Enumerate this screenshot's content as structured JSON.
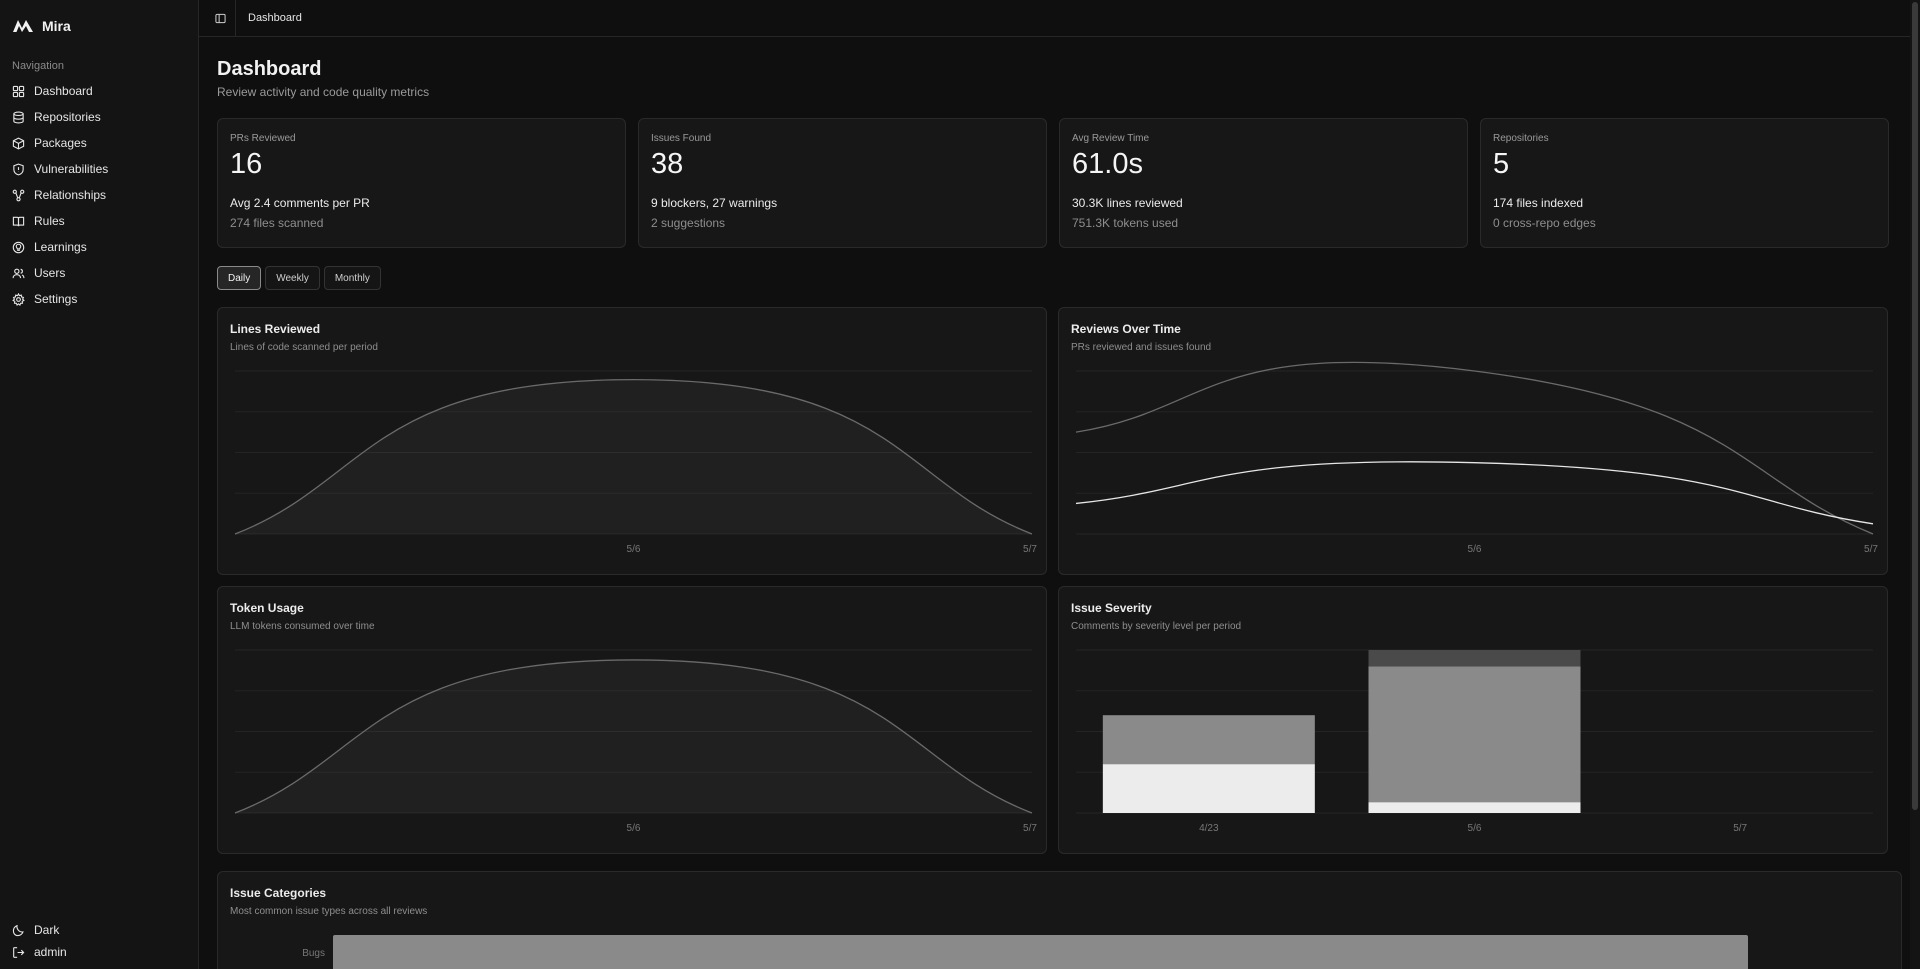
{
  "app": {
    "name": "Mira"
  },
  "sidebar": {
    "heading": "Navigation",
    "items": [
      {
        "label": "Dashboard",
        "icon": "dashboard-icon"
      },
      {
        "label": "Repositories",
        "icon": "database-icon"
      },
      {
        "label": "Packages",
        "icon": "package-icon"
      },
      {
        "label": "Vulnerabilities",
        "icon": "shield-icon"
      },
      {
        "label": "Relationships",
        "icon": "graph-icon"
      },
      {
        "label": "Rules",
        "icon": "book-icon"
      },
      {
        "label": "Learnings",
        "icon": "lightbulb-icon"
      },
      {
        "label": "Users",
        "icon": "users-icon"
      },
      {
        "label": "Settings",
        "icon": "gear-icon"
      }
    ],
    "footer": {
      "theme_label": "Dark",
      "user_label": "admin"
    }
  },
  "topbar": {
    "breadcrumb": "Dashboard"
  },
  "page": {
    "title": "Dashboard",
    "subtitle": "Review activity and code quality metrics"
  },
  "stats": [
    {
      "label": "PRs Reviewed",
      "value": "16",
      "line1": "Avg 2.4 comments per PR",
      "line2": "274 files scanned"
    },
    {
      "label": "Issues Found",
      "value": "38",
      "line1": "9 blockers, 27 warnings",
      "line2": "2 suggestions"
    },
    {
      "label": "Avg Review Time",
      "value": "61.0s",
      "line1": "30.3K lines reviewed",
      "line2": "751.3K tokens used"
    },
    {
      "label": "Repositories",
      "value": "5",
      "line1": "174 files indexed",
      "line2": "0 cross-repo edges"
    }
  ],
  "period": {
    "options": [
      "Daily",
      "Weekly",
      "Monthly"
    ],
    "selected": "Daily"
  },
  "cards": {
    "lines": {
      "title": "Lines Reviewed",
      "subtitle": "Lines of code scanned per period"
    },
    "reviews": {
      "title": "Reviews Over Time",
      "subtitle": "PRs reviewed and issues found"
    },
    "tokens": {
      "title": "Token Usage",
      "subtitle": "LLM tokens consumed over time"
    },
    "severity": {
      "title": "Issue Severity",
      "subtitle": "Comments by severity level per period"
    },
    "categories": {
      "title": "Issue Categories",
      "subtitle": "Most common issue types across all reviews"
    }
  },
  "colors": {
    "bg": "#0f0f0f",
    "card": "#171717",
    "line_primary": "#e6e6e6",
    "line_muted": "#6a6a6a",
    "bar_light": "#ececec",
    "bar_mid": "#8a8a8a",
    "bar_dark": "#4a4a4a"
  },
  "chart_data": [
    {
      "type": "area",
      "title": "Lines Reviewed",
      "x": [
        "",
        "5/6",
        "5/7"
      ],
      "tick_labels": [
        "5/6",
        "5/7"
      ],
      "series": [
        {
          "values": [
            0,
            30300,
            0
          ]
        }
      ],
      "ylim": [
        0,
        32000
      ],
      "grid": true
    },
    {
      "type": "line",
      "title": "Reviews Over Time",
      "x": [
        "",
        "5/6",
        "5/7"
      ],
      "tick_labels": [
        "5/6",
        "5/7"
      ],
      "series": [
        {
          "values": [
            10,
            16,
            0
          ]
        },
        {
          "values": [
            3,
            7,
            1
          ]
        }
      ],
      "ylim": [
        0,
        16
      ],
      "grid": true
    },
    {
      "type": "area",
      "title": "Token Usage",
      "x": [
        "",
        "5/6",
        "5/7"
      ],
      "tick_labels": [
        "5/6",
        "5/7"
      ],
      "series": [
        {
          "values": [
            0,
            751300,
            0
          ]
        }
      ],
      "ylim": [
        0,
        800000
      ],
      "grid": true
    },
    {
      "type": "bar",
      "title": "Issue Severity",
      "categories": [
        "4/23",
        "5/6",
        "5/7"
      ],
      "series": [
        {
          "values": [
            9,
            2,
            0
          ]
        },
        {
          "values": [
            9,
            25,
            0
          ]
        },
        {
          "values": [
            0,
            3,
            0
          ]
        }
      ],
      "ylim": [
        0,
        30
      ],
      "stacked": true,
      "grid": true
    },
    {
      "type": "bar",
      "title": "Issue Categories",
      "categories": [
        "Bugs"
      ],
      "values": [
        38
      ],
      "orientation": "horizontal"
    }
  ]
}
